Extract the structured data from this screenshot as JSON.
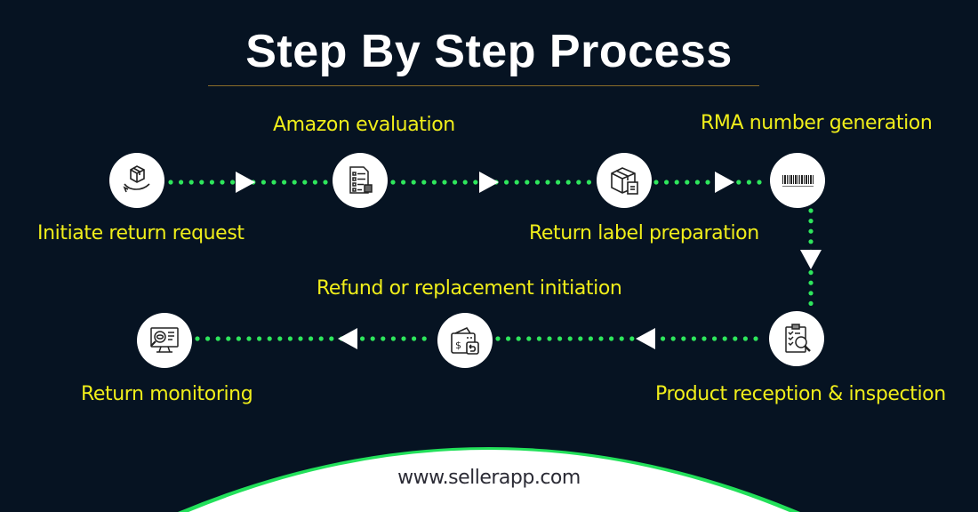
{
  "title": "Step By Step Process",
  "colors": {
    "background": "#061322",
    "label": "#f0ee1a",
    "connector": "#2ee65c",
    "node": "#ffffff",
    "footer_accent": "#22e05a"
  },
  "steps": [
    {
      "order": 1,
      "label": "Initiate return request",
      "icon": "hand-box-icon"
    },
    {
      "order": 2,
      "label": "Amazon evaluation",
      "icon": "checklist-icon"
    },
    {
      "order": 3,
      "label": "Return label preparation",
      "icon": "box-label-icon"
    },
    {
      "order": 4,
      "label": "RMA number generation",
      "icon": "barcode-icon"
    },
    {
      "order": 5,
      "label": "Product reception & inspection",
      "icon": "clipboard-search-icon"
    },
    {
      "order": 6,
      "label": "Refund or replacement initiation",
      "icon": "wallet-refund-icon"
    },
    {
      "order": 7,
      "label": "Return monitoring",
      "icon": "monitor-search-icon"
    }
  ],
  "footer": {
    "website": "www.sellerapp.com"
  }
}
